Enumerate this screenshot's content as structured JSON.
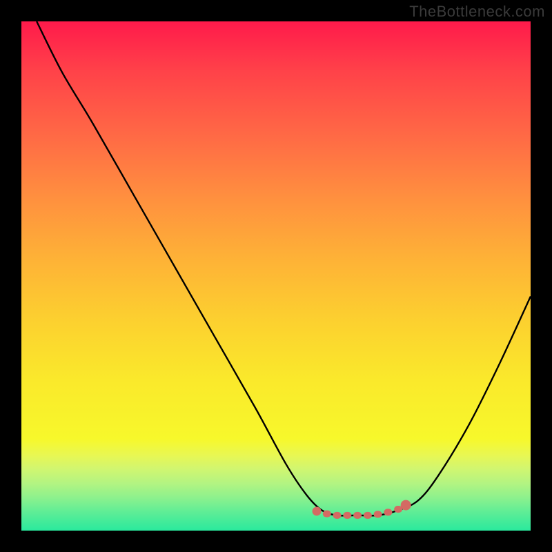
{
  "watermark": "TheBottleneck.com",
  "colors": {
    "background": "#000000",
    "curve": "#000000",
    "marker_fill": "#d46a63",
    "marker_stroke": "#c85a54"
  },
  "chart_data": {
    "type": "line",
    "title": "",
    "xlabel": "",
    "ylabel": "",
    "xlim": [
      0,
      100
    ],
    "ylim": [
      0,
      100
    ],
    "series": [
      {
        "name": "bottleneck-curve",
        "x": [
          3,
          8,
          14,
          22,
          30,
          38,
          46,
          52,
          56,
          59,
          62,
          66,
          70,
          74,
          78,
          82,
          88,
          94,
          100
        ],
        "y": [
          100,
          90,
          80,
          66,
          52,
          38,
          24,
          13,
          7,
          4,
          3,
          3,
          3,
          4,
          6,
          11,
          21,
          33,
          46
        ]
      }
    ],
    "annotations": [
      {
        "name": "optimal-range-markers",
        "type": "dots",
        "points_x": [
          58,
          60,
          62,
          64,
          66,
          68,
          70,
          72,
          74,
          75.5
        ],
        "points_y": [
          3.8,
          3.3,
          3.0,
          3.0,
          3.0,
          3.0,
          3.2,
          3.6,
          4.2,
          5.0
        ]
      }
    ]
  }
}
